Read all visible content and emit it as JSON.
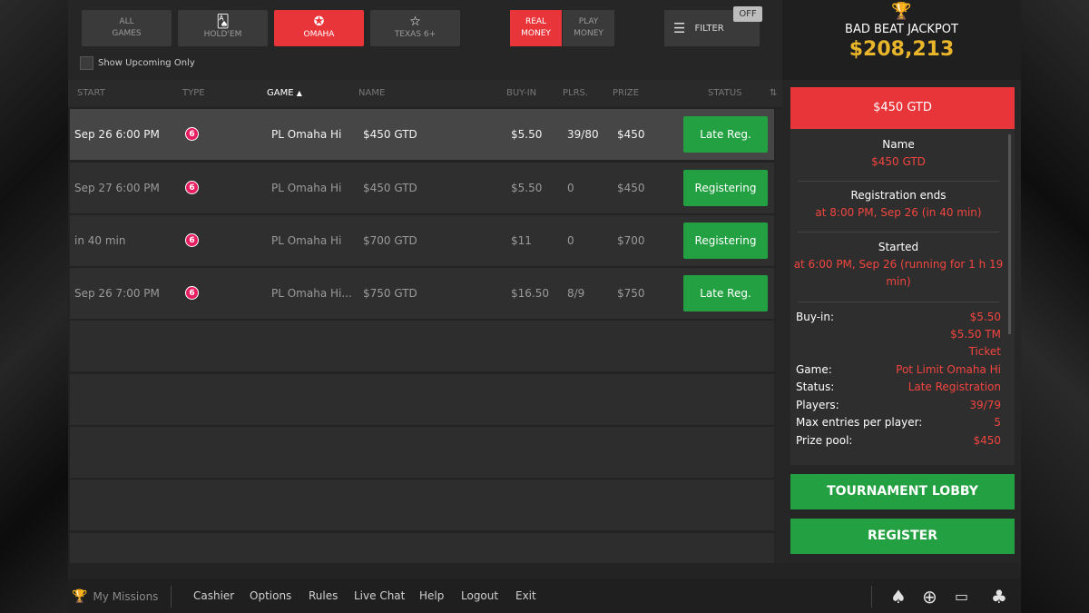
{
  "categories": [
    {
      "line1": "ALL",
      "line2": "GAMES",
      "icon": "",
      "active": false
    },
    {
      "line1": "",
      "line2": "HOLD'EM",
      "icon": "🂡",
      "active": false
    },
    {
      "line1": "",
      "line2": "OMAHA",
      "icon": "✪",
      "active": true
    },
    {
      "line1": "",
      "line2": "TEXAS 6+",
      "icon": "☆",
      "active": false
    }
  ],
  "money": {
    "real_line1": "REAL",
    "real_line2": "MONEY",
    "play_line1": "PLAY",
    "play_line2": "MONEY"
  },
  "filter": {
    "label": "FILTER",
    "state": "OFF"
  },
  "upcoming_label": "Show Upcoming Only",
  "columns": {
    "start": "START",
    "type": "TYPE",
    "game": "GAME",
    "name": "NAME",
    "buyin": "BUY-IN",
    "players": "PLRS.",
    "prize": "PRIZE",
    "status": "STATUS"
  },
  "rows": [
    {
      "start": "Sep 26 6:00 PM",
      "type": "6",
      "game": "PL Omaha Hi",
      "name": "$450 GTD",
      "buyin": "$5.50",
      "players": "39/80",
      "prize": "$450",
      "status": "Late Reg."
    },
    {
      "start": "Sep 27 6:00 PM",
      "type": "6",
      "game": "PL Omaha Hi",
      "name": "$450 GTD",
      "buyin": "$5.50",
      "players": "0",
      "prize": "$450",
      "status": "Registering"
    },
    {
      "start": "in 40 min",
      "type": "6",
      "game": "PL Omaha Hi",
      "name": "$700 GTD",
      "buyin": "$11",
      "players": "0",
      "prize": "$700",
      "status": "Registering"
    },
    {
      "start": "Sep 26 7:00 PM",
      "type": "6",
      "game": "PL Omaha Hi...",
      "name": "$750 GTD",
      "buyin": "$16.50",
      "players": "8/9",
      "prize": "$750",
      "status": "Late Reg."
    }
  ],
  "jackpot": {
    "title": "BAD BEAT JACKPOT",
    "amount": "$208,213"
  },
  "details": {
    "header": "$450 GTD",
    "name_label": "Name",
    "name_value": "$450 GTD",
    "reg_label": "Registration ends",
    "reg_value": "at 8:00 PM, Sep 26 (in 40 min)",
    "started_label": "Started",
    "started_value_1": "at 6:00 PM, Sep 26 (running for 1 h 19",
    "started_value_2": "min)",
    "buyin_label": "Buy-in:",
    "buyin_value_1": "$5.50",
    "buyin_value_2": "$5.50 TM",
    "buyin_value_3": "Ticket",
    "game_label": "Game:",
    "game_value": "Pot Limit Omaha Hi",
    "status_label": "Status:",
    "status_value": "Late Registration",
    "players_label": "Players:",
    "players_value": "39/79",
    "maxentries_label": "Max entries per player:",
    "maxentries_value": "5",
    "prizepool_label": "Prize pool:",
    "prizepool_value": "$450"
  },
  "actions": {
    "lobby": "TOURNAMENT LOBBY",
    "register": "REGISTER"
  },
  "bottom": {
    "missions": "My Missions",
    "cashier": "Cashier",
    "options": "Options",
    "rules": "Rules",
    "livechat": "Live Chat",
    "help": "Help",
    "logout": "Logout",
    "exit": "Exit"
  },
  "colors": {
    "accent_red": "#e8353a",
    "green": "#23a142",
    "gold": "#e9b52b"
  }
}
